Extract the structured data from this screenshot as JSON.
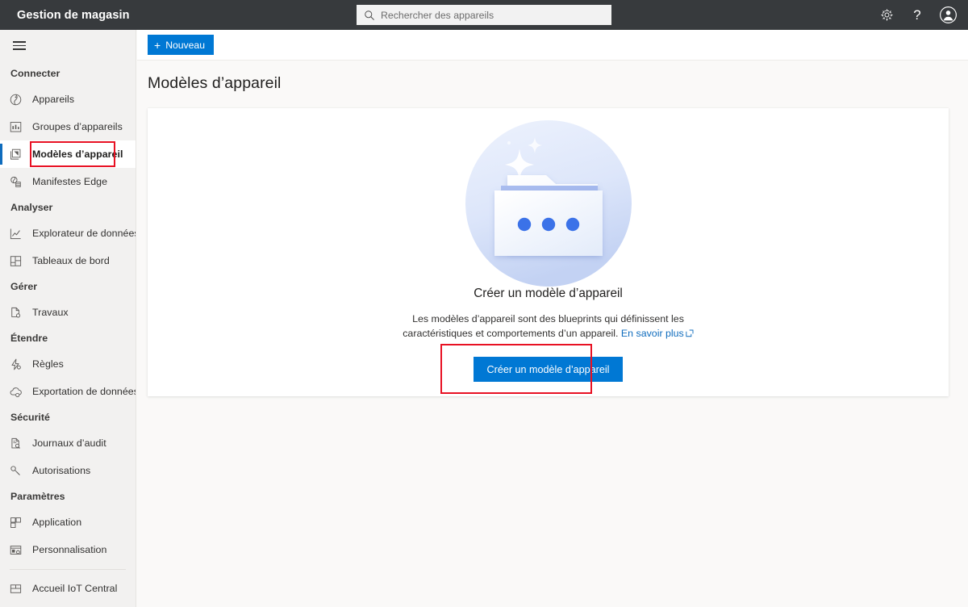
{
  "topbar": {
    "app_title": "Gestion de magasin",
    "search": {
      "placeholder": "Rechercher des appareils",
      "value": "",
      "icon": "search-icon"
    },
    "actions": [
      {
        "name": "settings-button",
        "icon": "gear-icon",
        "label": ""
      },
      {
        "name": "help-button",
        "icon": "question-mark-icon",
        "label": "?"
      },
      {
        "name": "account-button",
        "icon": "user-avatar-icon",
        "label": ""
      }
    ],
    "colors": {
      "background": "#373a3d",
      "text": "#ffffff"
    }
  },
  "sidebar": {
    "menu_toggle": {
      "name": "hamburger-menu-button",
      "icon": "hamburger-icon"
    },
    "groups": [
      {
        "title": "Connecter",
        "items": [
          {
            "label": "Appareils",
            "icon": "devices-icon",
            "selected": false
          },
          {
            "label": "Groupes d’appareils",
            "icon": "device-groups-icon",
            "selected": false
          },
          {
            "label": "Modèles d’appareil",
            "icon": "device-templates-icon",
            "selected": true
          },
          {
            "label": "Manifestes Edge",
            "icon": "edge-manifests-icon",
            "selected": false
          }
        ]
      },
      {
        "title": "Analyser",
        "items": [
          {
            "label": "Explorateur de données",
            "icon": "data-explorer-icon",
            "selected": false
          },
          {
            "label": "Tableaux de bord",
            "icon": "dashboards-icon",
            "selected": false
          }
        ]
      },
      {
        "title": "Gérer",
        "items": [
          {
            "label": "Travaux",
            "icon": "jobs-icon",
            "selected": false
          }
        ]
      },
      {
        "title": "Étendre",
        "items": [
          {
            "label": "Règles",
            "icon": "rules-icon",
            "selected": false
          },
          {
            "label": "Exportation de données",
            "icon": "data-export-icon",
            "selected": false
          }
        ]
      },
      {
        "title": "Sécurité",
        "items": [
          {
            "label": "Journaux d’audit",
            "icon": "audit-logs-icon",
            "selected": false
          },
          {
            "label": "Autorisations",
            "icon": "permissions-key-icon",
            "selected": false
          }
        ]
      },
      {
        "title": "Paramètres",
        "items": [
          {
            "label": "Application",
            "icon": "application-icon",
            "selected": false
          },
          {
            "label": "Personnalisation",
            "icon": "customization-icon",
            "selected": false
          }
        ]
      }
    ],
    "footer_items": [
      {
        "label": "Accueil IoT Central",
        "icon": "iot-central-home-icon",
        "selected": false
      }
    ],
    "selection_highlight_color": "#e81123",
    "accent_color": "#0f6cbd"
  },
  "command_bar": {
    "new_button": {
      "label": "Nouveau",
      "icon": "plus-icon"
    }
  },
  "main": {
    "page_title": "Modèles d’appareil",
    "empty_state": {
      "illustration": "folder-with-dots-illustration",
      "heading": "Créer un modèle d’appareil",
      "description_line1": "Les modèles d’appareil sont des blueprints qui définissent les",
      "description_line2": "caractéristiques et comportements d’un appareil.",
      "learn_more_label": "En savoir plus",
      "learn_more_icon": "external-link-icon",
      "cta_label": "Créer un modèle d’appareil",
      "cta_color": "#0078d4",
      "cta_highlight_color": "#e81123"
    }
  }
}
